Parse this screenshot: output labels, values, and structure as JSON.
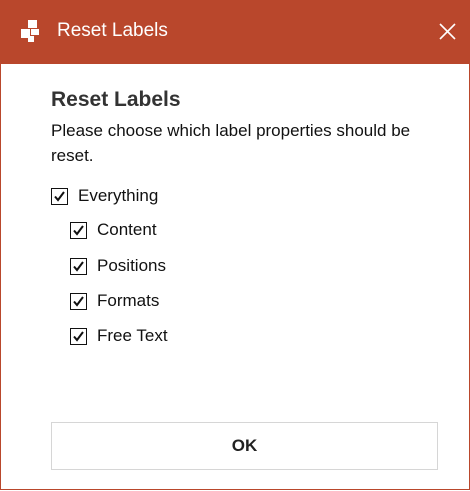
{
  "window": {
    "title": "Reset Labels",
    "accent_color": "#b9472c",
    "icon": "app-logo-icon",
    "close_icon": "close-icon"
  },
  "dialog": {
    "heading": "Reset Labels",
    "description": "Please choose which label properties should be reset.",
    "options": [
      {
        "label": "Everything",
        "checked": true,
        "level": 0
      },
      {
        "label": "Content",
        "checked": true,
        "level": 1
      },
      {
        "label": "Positions",
        "checked": true,
        "level": 1
      },
      {
        "label": "Formats",
        "checked": true,
        "level": 1
      },
      {
        "label": "Free Text",
        "checked": true,
        "level": 1
      }
    ],
    "ok_label": "OK"
  }
}
